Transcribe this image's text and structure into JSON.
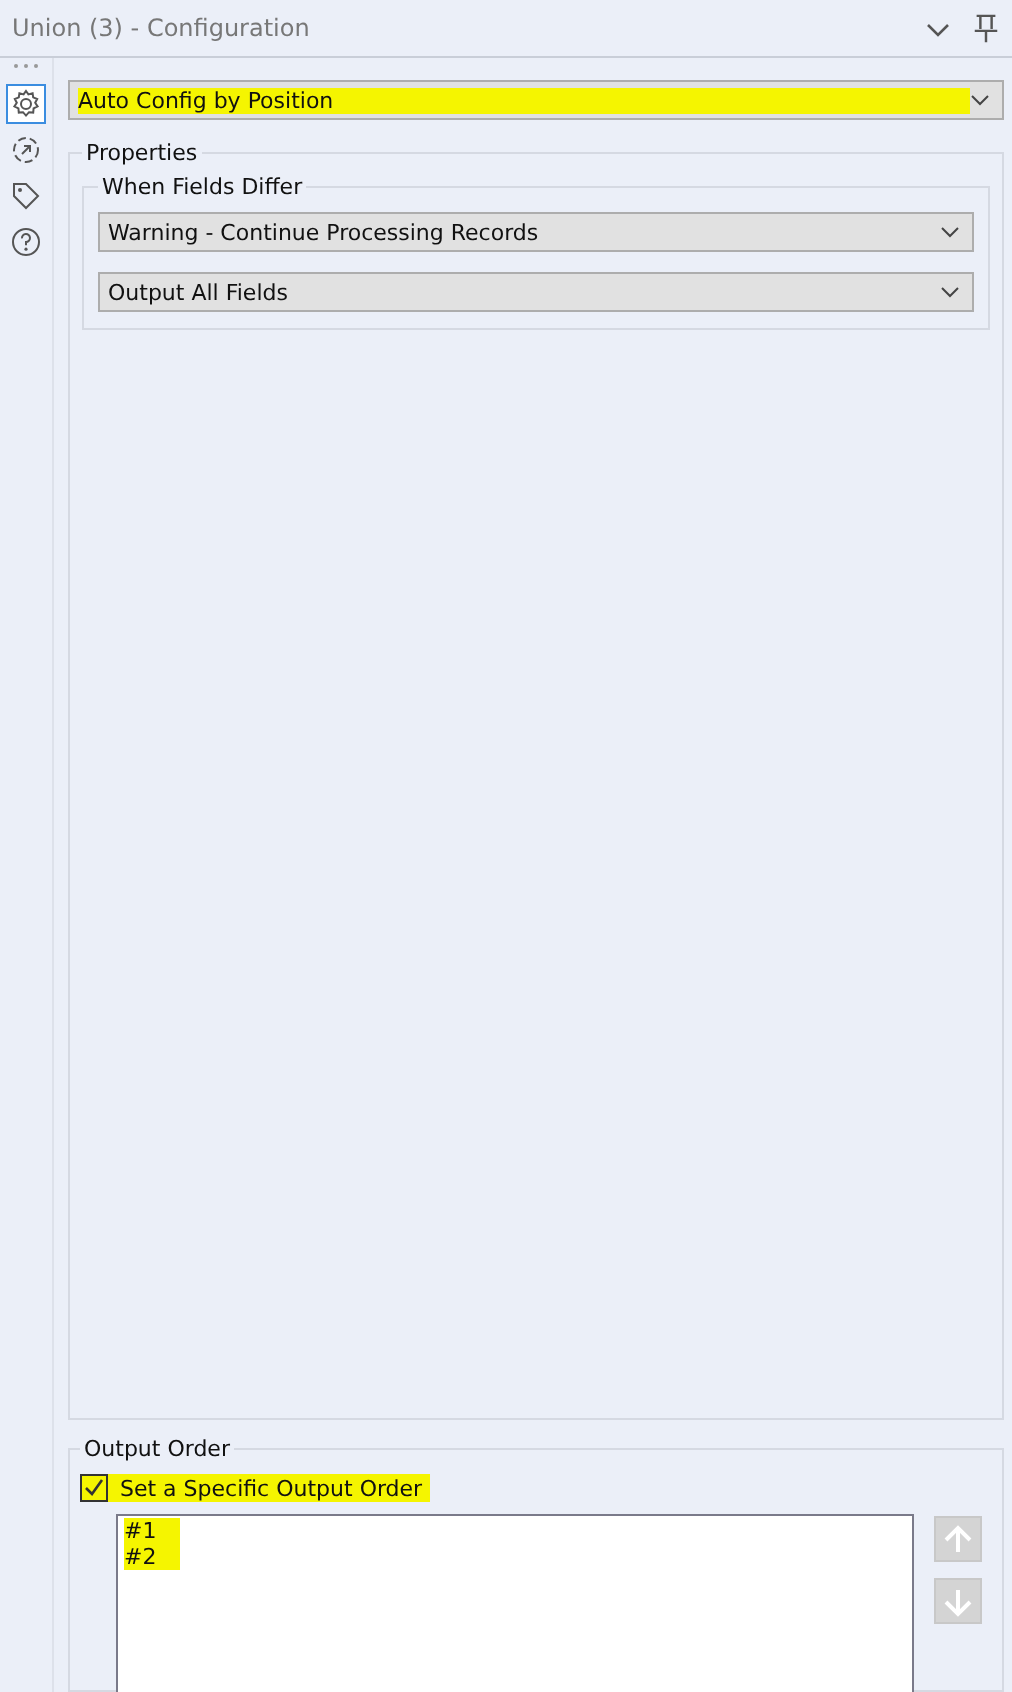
{
  "panel": {
    "title": "Union (3) - Configuration"
  },
  "sidebar": {
    "items": [
      {
        "kind": "gear",
        "selected": true
      },
      {
        "kind": "arrow",
        "selected": false
      },
      {
        "kind": "tag",
        "selected": false
      },
      {
        "kind": "help",
        "selected": false
      }
    ]
  },
  "mode_dropdown": {
    "value": "Auto Config by Position",
    "highlighted": true
  },
  "properties": {
    "title": "Properties",
    "when_fields_differ": {
      "title": "When Fields Differ",
      "dropdowns": [
        {
          "value": "Warning - Continue Processing Records"
        },
        {
          "value": "Output All Fields"
        }
      ]
    }
  },
  "output_order": {
    "title": "Output Order",
    "checkbox": {
      "label": "Set a Specific Output Order",
      "checked": true,
      "highlighted": true
    },
    "list": [
      {
        "text": "#1",
        "highlighted": true
      },
      {
        "text": "#2",
        "highlighted": true
      }
    ],
    "buttons": [
      {
        "kind": "up",
        "disabled": true
      },
      {
        "kind": "down",
        "disabled": true
      }
    ]
  }
}
